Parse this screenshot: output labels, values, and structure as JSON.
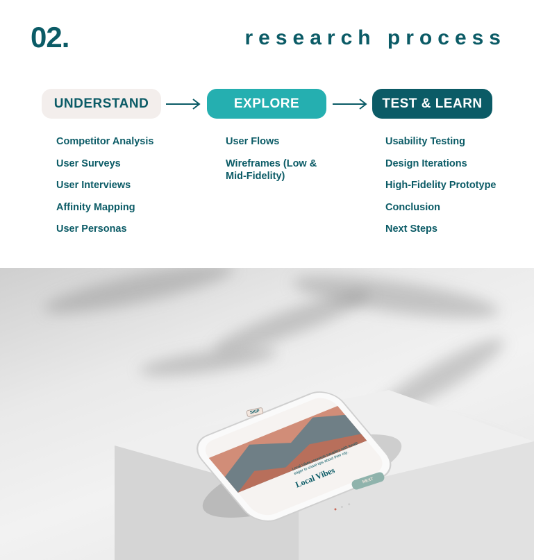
{
  "header": {
    "number": "02.",
    "title": "research process"
  },
  "stages": [
    {
      "label": "UNDERSTAND",
      "items": [
        "Competitor Analysis",
        "User Surveys",
        "User Interviews",
        "Affinity Mapping",
        "User Personas"
      ]
    },
    {
      "label": "EXPLORE",
      "items": [
        "User Flows",
        "Wireframes (Low & Mid-Fidelity)"
      ]
    },
    {
      "label": "TEST & LEARN",
      "items": [
        "Usability Testing",
        "Design Iterations",
        "High-Fidelity Prototype",
        "Conclusion",
        "Next Steps"
      ]
    }
  ],
  "phone": {
    "skip_label": "SKIP",
    "app_title": "Local Vibes",
    "app_body": "Local Vibes connects travelers with locals eager to share tips about their city.",
    "next_label": "NEXT"
  },
  "colors": {
    "dark_teal": "#0b5b66",
    "teal": "#25afb0",
    "beige": "#f3eeec"
  }
}
